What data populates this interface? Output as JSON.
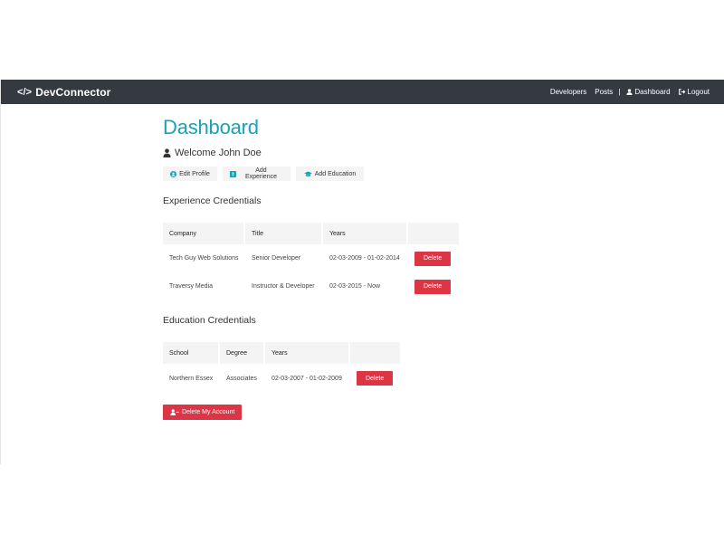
{
  "navbar": {
    "brand_code": "</>",
    "brand": "DevConnector",
    "links": {
      "developers": "Developers",
      "posts": "Posts",
      "separator": "|",
      "dashboard": "Dashboard",
      "logout": "Logout"
    }
  },
  "dashboard": {
    "title": "Dashboard",
    "welcome": "Welcome John Doe",
    "actions": {
      "edit_profile": "Edit Profile",
      "add_experience": "Add Experience",
      "add_education": "Add Education"
    }
  },
  "experience": {
    "title": "Experience Credentials",
    "headers": {
      "company": "Company",
      "title": "Title",
      "years": "Years"
    },
    "rows": [
      {
        "company": "Tech Guy Web Solutions",
        "title": "Senior Developer",
        "years": "02-03-2009 - 01-02-2014",
        "delete": "Delete"
      },
      {
        "company": "Traversy Media",
        "title": "Instructor & Developer",
        "years": "02-03-2015 - Now",
        "delete": "Delete"
      }
    ]
  },
  "education": {
    "title": "Education Credentials",
    "headers": {
      "school": "School",
      "degree": "Degree",
      "years": "Years"
    },
    "rows": [
      {
        "school": "Northern Essex",
        "degree": "Associates",
        "years": "02-03-2007 - 01-02-2009",
        "delete": "Delete"
      }
    ]
  },
  "delete_account": "Delete My Account",
  "colors": {
    "navbar_bg": "#343a40",
    "primary_teal": "#17a2b8",
    "danger": "#dc3545",
    "light": "#f4f4f4"
  },
  "icons": {
    "brand": "code-icon",
    "dashboard": "user-icon",
    "logout": "sign-out-icon",
    "welcome": "user-icon",
    "edit_profile": "user-circle-icon",
    "add_experience": "black-tie-icon",
    "add_education": "graduation-cap-icon",
    "delete_account": "user-minus-icon"
  }
}
